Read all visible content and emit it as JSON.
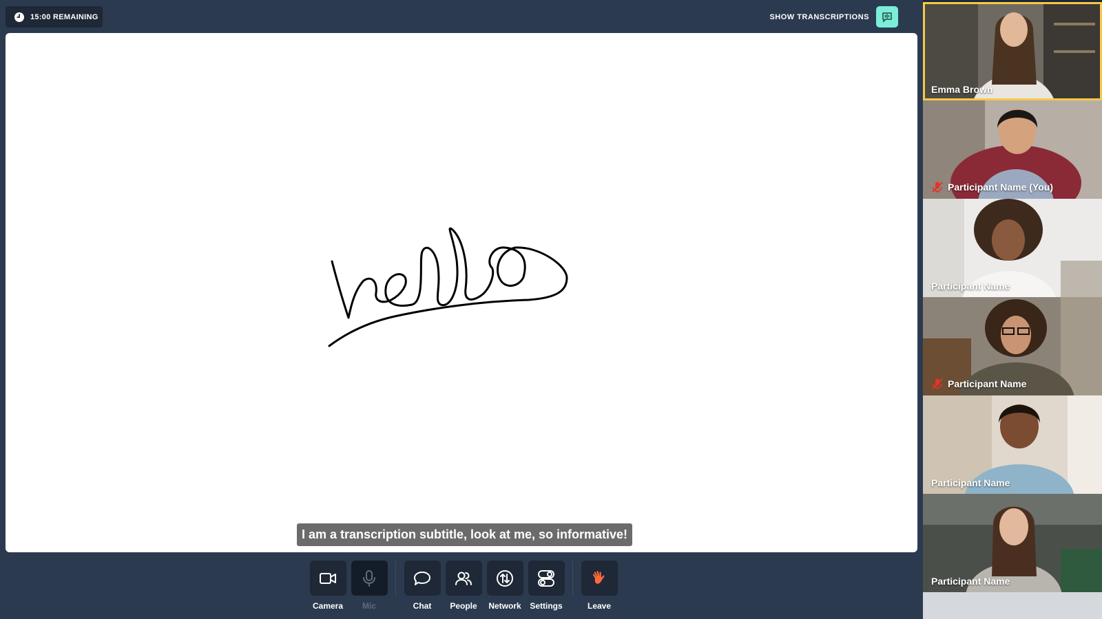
{
  "timer": {
    "label": "15:00 REMAINING",
    "icon": "clock-icon"
  },
  "transcriptions": {
    "label": "SHOW TRANSCRIPTIONS",
    "icon": "transcription-icon",
    "accent": "#7cedd8"
  },
  "stage": {
    "subtitle": "I am a transcription subtitle, look at me, so informative!"
  },
  "toolbar": {
    "camera": "Camera",
    "mic": "Mic",
    "chat": "Chat",
    "people": "People",
    "network": "Network",
    "settings": "Settings",
    "leave": "Leave"
  },
  "participants": [
    {
      "name": "Emma Brown",
      "muted": false,
      "active": true
    },
    {
      "name": "Participant Name (You)",
      "muted": true,
      "active": false
    },
    {
      "name": "Participant Name",
      "muted": false,
      "active": false
    },
    {
      "name": "Participant Name",
      "muted": true,
      "active": false
    },
    {
      "name": "Participant Name",
      "muted": false,
      "active": false
    },
    {
      "name": "Participant Name",
      "muted": false,
      "active": false
    }
  ],
  "colors": {
    "background": "#2b3a4f",
    "panel": "#1e2836",
    "active_border": "#f7c948",
    "leave": "#ff6a3d",
    "muted": "#e5332a"
  }
}
